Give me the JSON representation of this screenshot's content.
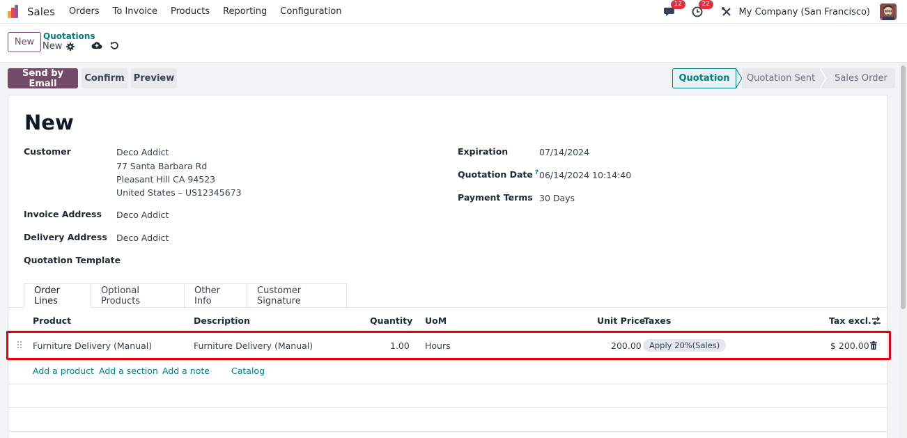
{
  "navbar": {
    "app_name": "Sales",
    "menu": [
      "Orders",
      "To Invoice",
      "Products",
      "Reporting",
      "Configuration"
    ],
    "messages_count": "12",
    "activities_count": "22",
    "company": "My Company (San Francisco)"
  },
  "control": {
    "new_label": "New",
    "breadcrumb_parent": "Quotations",
    "breadcrumb_current": "New"
  },
  "actions": {
    "send_email": "Send by Email",
    "confirm": "Confirm",
    "preview": "Preview"
  },
  "status": {
    "stages": [
      "Quotation",
      "Quotation Sent",
      "Sales Order"
    ],
    "active": "Quotation"
  },
  "form": {
    "title": "New",
    "customer_label": "Customer",
    "customer_name": "Deco Addict",
    "customer_address_1": "77 Santa Barbara Rd",
    "customer_address_2": "Pleasant Hill CA 94523",
    "customer_address_3": "United States – US12345673",
    "invoice_address_label": "Invoice Address",
    "invoice_address": "Deco Addict",
    "delivery_address_label": "Delivery Address",
    "delivery_address": "Deco Addict",
    "quotation_template_label": "Quotation Template",
    "expiration_label": "Expiration",
    "expiration": "07/14/2024",
    "quotation_date_label": "Quotation Date",
    "quotation_date_help": "?",
    "quotation_date": "06/14/2024 10:14:40",
    "payment_terms_label": "Payment Terms",
    "payment_terms": "30 Days"
  },
  "tabs": [
    "Order Lines",
    "Optional Products",
    "Other Info",
    "Customer Signature"
  ],
  "order_lines": {
    "headers": {
      "product": "Product",
      "description": "Description",
      "quantity": "Quantity",
      "uom": "UoM",
      "unit_price": "Unit Price",
      "taxes": "Taxes",
      "tax_excl": "Tax excl."
    },
    "rows": [
      {
        "product": "Furniture Delivery (Manual)",
        "description": "Furniture Delivery (Manual)",
        "quantity": "1.00",
        "uom": "Hours",
        "unit_price": "200.00",
        "taxes": "Apply 20%(Sales)",
        "tax_excl": "$ 200.00"
      }
    ],
    "links": [
      "Add a product",
      "Add a section",
      "Add a note",
      "Catalog"
    ]
  },
  "colors": {
    "brand": "#714b67",
    "accent": "#017e84",
    "highlight": "#e3000f",
    "badge": "#e0303e"
  }
}
